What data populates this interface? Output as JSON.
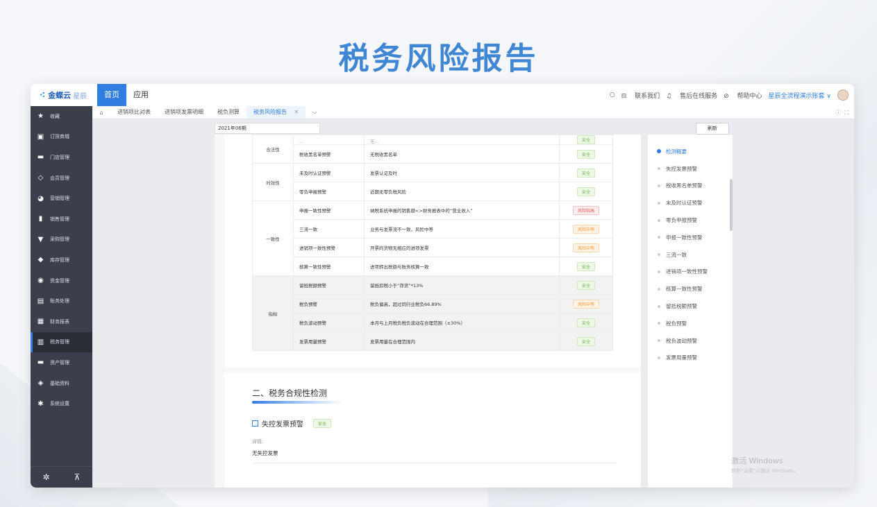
{
  "headline": "税务风险报告",
  "app": {
    "logo": "金蝶云",
    "logo_sub": "星辰"
  },
  "topnav": [
    {
      "label": "首页"
    },
    {
      "label": "应用"
    }
  ],
  "topright": {
    "contact": "联系我们",
    "service": "售后在线服务",
    "help": "帮助中心",
    "account": "星辰全流程演示账套 ∨"
  },
  "sidebar": [
    {
      "icon": "star-icon",
      "glyph": "★",
      "label": "收藏"
    },
    {
      "icon": "mall-icon",
      "glyph": "▣",
      "label": "订货商城"
    },
    {
      "icon": "store-icon",
      "glyph": "▬",
      "label": "门店管理"
    },
    {
      "icon": "diamond-icon",
      "glyph": "◇",
      "label": "会员管理"
    },
    {
      "icon": "marketing-icon",
      "glyph": "◕",
      "label": "营销管理"
    },
    {
      "icon": "bar-chart-icon",
      "glyph": "▮",
      "label": "销售管理"
    },
    {
      "icon": "cart-icon",
      "glyph": "▼",
      "label": "采购管理"
    },
    {
      "icon": "cube-icon",
      "glyph": "◆",
      "label": "库存管理"
    },
    {
      "icon": "fund-icon",
      "glyph": "◉",
      "label": "资金管理"
    },
    {
      "icon": "ledger-icon",
      "glyph": "▤",
      "label": "账务处理"
    },
    {
      "icon": "report-icon",
      "glyph": "▦",
      "label": "财务报表"
    },
    {
      "icon": "tax-icon",
      "glyph": "▥",
      "label": "税务管理"
    },
    {
      "icon": "asset-icon",
      "glyph": "▬",
      "label": "资产管理"
    },
    {
      "icon": "layers-icon",
      "glyph": "◈",
      "label": "基础资料"
    },
    {
      "icon": "settings-icon",
      "glyph": "✱",
      "label": "系统设置"
    }
  ],
  "sidebar_active_index": 11,
  "tabs": [
    {
      "label": "进销项比对表"
    },
    {
      "label": "进销项发票明细"
    },
    {
      "label": "税负测算"
    },
    {
      "label": "税务风险报告"
    }
  ],
  "period": "2021年06期",
  "refresh_label": "刷新",
  "table": {
    "rows": [
      {
        "cat": "合法性",
        "span": 2,
        "name": "...",
        "desc": "无...",
        "status": "安全",
        "level": "safe",
        "clip": true
      },
      {
        "cat": "",
        "name": "税收黑名单预警",
        "desc": "无税收黑名单",
        "status": "安全",
        "level": "safe"
      },
      {
        "cat": "时效性",
        "span": 2,
        "name": "未及时认证预警",
        "desc": "发票认证及时",
        "status": "安全",
        "level": "safe"
      },
      {
        "cat": "",
        "name": "零负申报预警",
        "desc": "近期无零负税风险",
        "status": "安全",
        "level": "safe"
      },
      {
        "cat": "一致性",
        "span": 4,
        "name": "申报一致性预警",
        "desc": "纳税系统申报的销售额<>财务报表中的“营业收入”",
        "status": "风险较高",
        "level": "high"
      },
      {
        "cat": "",
        "name": "三流一致",
        "desc": "业务与发票流不一致，风险中等",
        "status": "风险中等",
        "level": "mid"
      },
      {
        "cat": "",
        "name": "进销项一致性预警",
        "desc": "开票的货物无相应的进项发票",
        "status": "风险中等",
        "level": "mid"
      },
      {
        "cat": "",
        "name": "核算一致性预警",
        "desc": "进项转出税额与账务核算一致",
        "status": "安全",
        "level": "safe"
      },
      {
        "cat": "指标",
        "span": 4,
        "name": "留抵税额预警",
        "desc": "留抵扣税小于“存货”*13%",
        "status": "安全",
        "level": "safe",
        "gray": true
      },
      {
        "cat": "",
        "name": "税负预警",
        "desc": "税负偏高，超过同行业税负66.89%",
        "status": "风险中等",
        "level": "mid",
        "gray": true
      },
      {
        "cat": "",
        "name": "税负波动预警",
        "desc": "本月与上月税负税负波动在合理范围（±30%）",
        "status": "安全",
        "level": "safe",
        "gray": true
      },
      {
        "cat": "",
        "name": "发票用量预警",
        "desc": "发票用量在合理范围内",
        "status": "安全",
        "level": "safe",
        "gray": true
      }
    ]
  },
  "section2": {
    "title": "二、税务合规性检测",
    "item_title": "失控发票预警",
    "item_status": "安全",
    "detail_label": "详情:",
    "detail_value": "无失控发票"
  },
  "outline": [
    "检测概要",
    "失控发票预警",
    "税收黑名单预警",
    "未及时认证预警",
    "零负申报预警",
    "申报一致性预警",
    "三流一致",
    "进销项一致性预警",
    "核算一致性预警",
    "留抵税额预警",
    "税负预警",
    "税负波动预警",
    "发票用量预警"
  ],
  "watermark": {
    "line1": "激活 Windows",
    "line2": "转到“设置”以激活 Windows。"
  },
  "colors": {
    "accent": "#2f7de1",
    "headline": "#3f86d4",
    "sidebar": "#3b3f4b",
    "safe": "#6cb24a",
    "mid": "#f59a3a",
    "high": "#e75f5f"
  }
}
